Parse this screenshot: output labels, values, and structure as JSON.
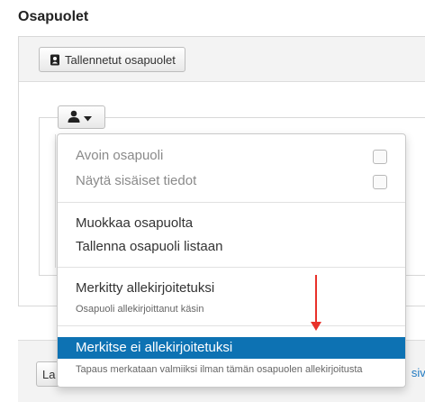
{
  "section": {
    "title": "Osapuolet"
  },
  "toolbar": {
    "saved_parties_label": "Tallennetut osapuolet"
  },
  "footer": {
    "left_button_label": "La",
    "right_link_text": "sivu"
  },
  "dropdown": {
    "open_party_label": "Avoin osapuoli",
    "show_internal_label": "Näytä sisäiset tiedot",
    "edit_party_label": "Muokkaa osapuolta",
    "save_party_list_label": "Tallenna osapuoli listaan",
    "marked_signed_label": "Merkitty allekirjoitetuksi",
    "marked_signed_desc": "Osapuoli allekirjoittanut käsin",
    "mark_unsigned_label": "Merkitse ei allekirjoitetuksi",
    "mark_unsigned_desc": "Tapaus merkataan valmiiksi ilman tämän osapuolen allekirjoitusta"
  },
  "colors": {
    "highlight": "#0d72b3",
    "arrow": "#e8312a",
    "link": "#1f7ac2"
  },
  "icons": {
    "saved_parties": "contact-book-icon",
    "user_menu": "user-icon",
    "caret": "caret-down-icon"
  }
}
